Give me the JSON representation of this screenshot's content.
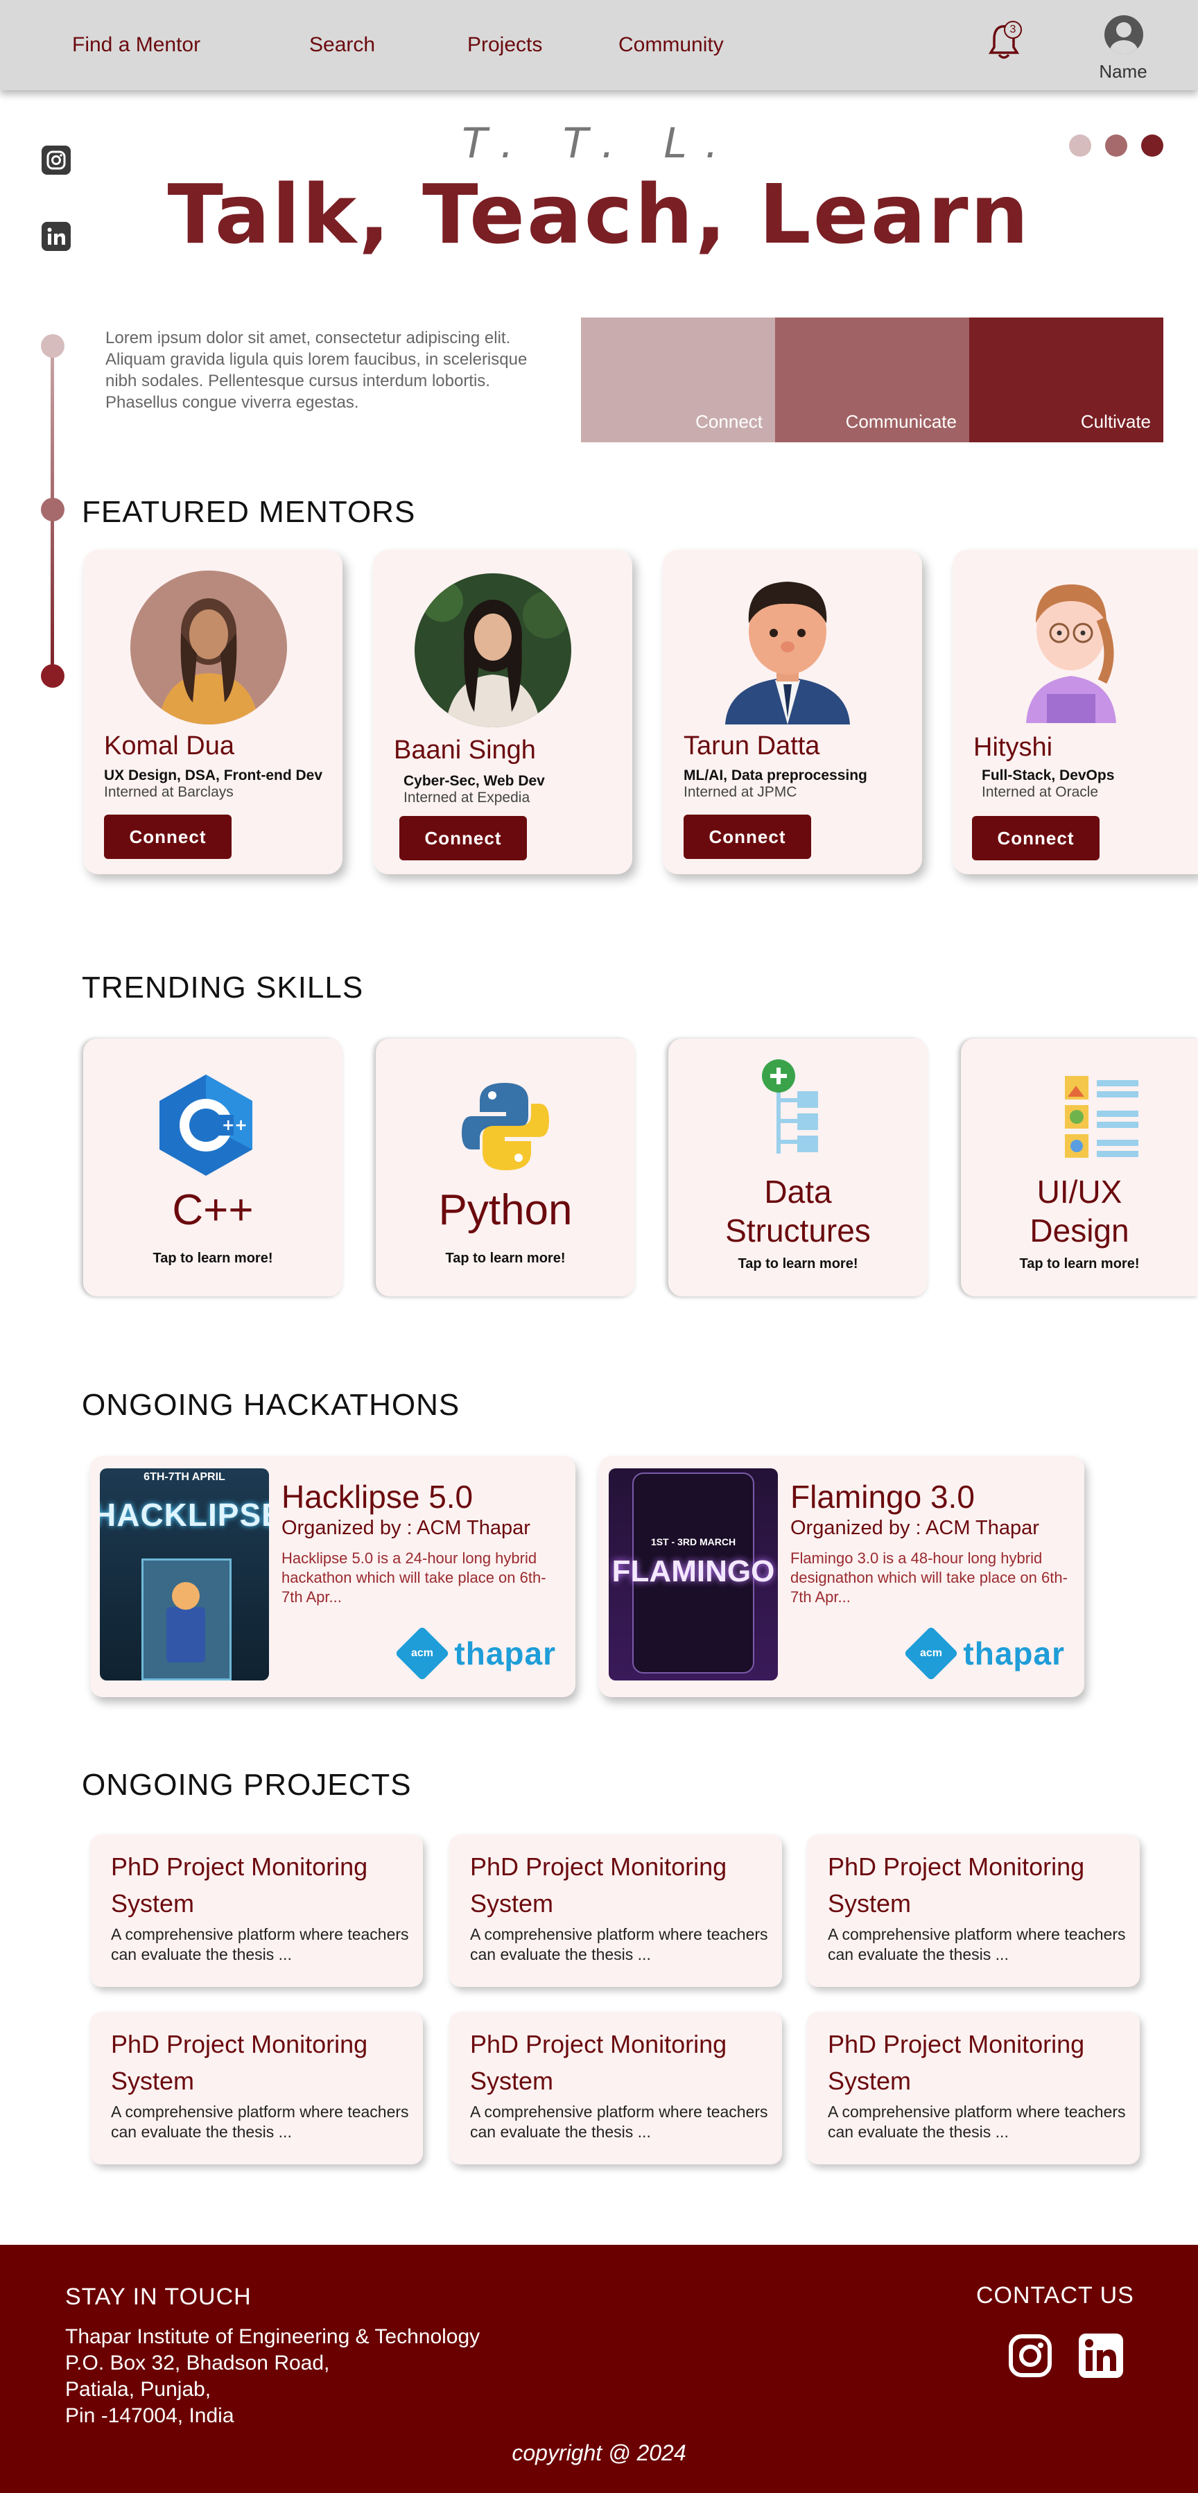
{
  "nav": {
    "links": [
      "Find a Mentor",
      "Search",
      "Projects",
      "Community"
    ],
    "notification_count": "3",
    "profile_label": "Name"
  },
  "hero": {
    "abbrev": "T. T. L.",
    "title": "Talk, Teach, Learn",
    "intro": "Lorem ipsum dolor sit amet, consectetur adipiscing elit. Aliquam gravida ligula quis lorem faucibus, in scelerisque nibh sodales. Pellentesque cursus interdum lobortis. Phasellus congue viverra egestas.",
    "swatches": [
      {
        "label": "Connect",
        "color": "#c9adae"
      },
      {
        "label": "Communicate",
        "color": "#a06264"
      },
      {
        "label": "Cultivate",
        "color": "#7a1f24"
      }
    ],
    "dots": [
      "#d6bcbd",
      "#a76a6c",
      "#7a1f24"
    ]
  },
  "mentors": {
    "heading": "FEATURED MENTORS",
    "connect_label": "Connect",
    "items": [
      {
        "name": "Komal Dua",
        "skills": "UX Design, DSA, Front-end Dev",
        "intern": "Interned at Barclays"
      },
      {
        "name": "Baani Singh",
        "skills": "Cyber-Sec, Web Dev",
        "intern": "Interned at Expedia"
      },
      {
        "name": "Tarun Datta",
        "skills": "ML/AI, Data preprocessing",
        "intern": "Interned at JPMC"
      },
      {
        "name": "Hityshi",
        "skills": "Full-Stack, DevOps",
        "intern": "Interned at Oracle"
      }
    ]
  },
  "skills": {
    "heading": "TRENDING SKILLS",
    "tap_label": "Tap to learn more!",
    "items": [
      {
        "line1": "C++",
        "line2": ""
      },
      {
        "line1": "Python",
        "line2": ""
      },
      {
        "line1": "Data",
        "line2": "Structures"
      },
      {
        "line1": "UI/UX",
        "line2": "Design"
      }
    ]
  },
  "hackathons": {
    "heading": "ONGOING HACKATHONS",
    "items": [
      {
        "title": "Hacklipse 5.0",
        "org": "Organized by : ACM Thapar",
        "desc": "Hacklipse 5.0 is a 24-hour long hybrid hackathon which will take place on 6th-7th Apr...",
        "poster_text": "HACKLIPSE",
        "poster_date": "6TH-7TH APRIL"
      },
      {
        "title": "Flamingo 3.0",
        "org": "Organized by : ACM Thapar",
        "desc": "Flamingo 3.0 is a 48-hour long hybrid designathon which will take place on 6th-7th Apr...",
        "poster_text": "FLAMINGO",
        "poster_date": "1ST - 3RD MARCH"
      }
    ],
    "logo_badge": "acm",
    "logo_text": "thapar"
  },
  "projects": {
    "heading": "ONGOING PROJECTS",
    "items": [
      {
        "title": "PhD Project Monitoring System",
        "desc": "A comprehensive platform where teachers can evaluate the thesis ..."
      },
      {
        "title": "PhD Project Monitoring System",
        "desc": "A comprehensive platform where teachers can evaluate the thesis ..."
      },
      {
        "title": "PhD Project Monitoring System",
        "desc": "A comprehensive platform where teachers can evaluate the thesis ..."
      },
      {
        "title": "PhD Project Monitoring System",
        "desc": "A comprehensive platform where teachers can evaluate the thesis ..."
      },
      {
        "title": "PhD Project Monitoring System",
        "desc": "A comprehensive platform where teachers can evaluate the thesis ..."
      },
      {
        "title": "PhD Project Monitoring System",
        "desc": "A comprehensive platform where teachers can evaluate the thesis ..."
      }
    ]
  },
  "footer": {
    "stay_heading": "STAY IN TOUCH",
    "address": [
      "Thapar Institute of Engineering & Technology",
      "P.O. Box 32, Bhadson Road,",
      "Patiala, Punjab,",
      "Pin -147004, India"
    ],
    "contact_heading": "CONTACT US",
    "copyright": "copyright @ 2024",
    "brand_color": "#6b0000"
  },
  "icons": [
    "instagram-icon",
    "linkedin-icon",
    "bell-icon",
    "user-icon",
    "python-icon",
    "cpp-icon",
    "tree-icon",
    "uiux-icon"
  ]
}
